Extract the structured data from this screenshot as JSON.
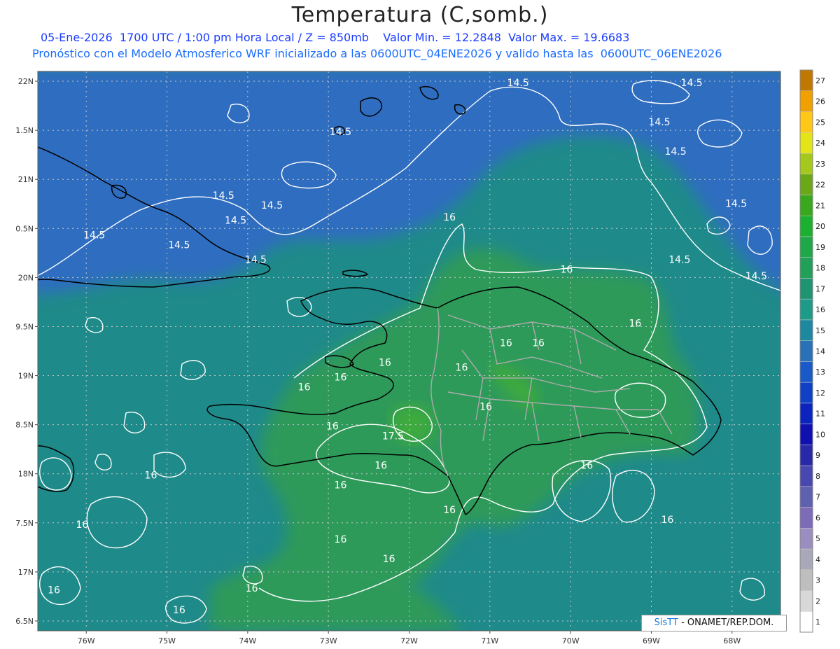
{
  "header": {
    "title": "Temperatura (C,somb.)",
    "line1": "05-Ene-2026  1700 UTC / 1:00 pm Hora Local / Z = 850mb    Valor Min. = 12.2848  Valor Max. = 19.6683",
    "line2": "Pronóstico con el Modelo Atmosferico WRF inicializado a las 0600UTC_04ENE2026 y valido hasta las  0600UTC_06ENE2026"
  },
  "map": {
    "lat_range": [
      16.4,
      22.1
    ],
    "lon_range": [
      -76.6,
      -67.4
    ],
    "lat_ticks": [
      {
        "value": 22,
        "label": "22N"
      },
      {
        "value": 21.5,
        "label": "1.5N"
      },
      {
        "value": 21,
        "label": "21N"
      },
      {
        "value": 20.5,
        "label": "0.5N"
      },
      {
        "value": 20,
        "label": "20N"
      },
      {
        "value": 19.5,
        "label": "9.5N"
      },
      {
        "value": 19,
        "label": "19N"
      },
      {
        "value": 18.5,
        "label": "8.5N"
      },
      {
        "value": 18,
        "label": "18N"
      },
      {
        "value": 17.5,
        "label": "7.5N"
      },
      {
        "value": 17,
        "label": "17N"
      },
      {
        "value": 16.5,
        "label": "6.5N"
      }
    ],
    "lon_ticks": [
      {
        "value": -76,
        "label": "76W"
      },
      {
        "value": -75,
        "label": "75W"
      },
      {
        "value": -74,
        "label": "74W"
      },
      {
        "value": -73,
        "label": "73W"
      },
      {
        "value": -72,
        "label": "72W"
      },
      {
        "value": -71,
        "label": "71W"
      },
      {
        "value": -70,
        "label": "70W"
      },
      {
        "value": -69,
        "label": "69W"
      },
      {
        "value": -68,
        "label": "68W"
      }
    ],
    "colors": {
      "ocean_cold": "#2e6dbf",
      "ocean": "#1f8a8a",
      "land_warm": "#2f9a5a",
      "land_hot": "#3caa3c",
      "contour": "#ffffff",
      "coast": "#000000",
      "border": "#aaaaaa"
    },
    "contour_labels": [
      {
        "text": "14.5",
        "lat": 21.95,
        "lon": -70.65
      },
      {
        "text": "14.5",
        "lat": 21.95,
        "lon": -68.5
      },
      {
        "text": "14.5",
        "lat": 21.55,
        "lon": -68.9
      },
      {
        "text": "14.5",
        "lat": 21.45,
        "lon": -72.85
      },
      {
        "text": "14.5",
        "lat": 21.25,
        "lon": -68.7
      },
      {
        "text": "14.5",
        "lat": 20.8,
        "lon": -74.3
      },
      {
        "text": "14.5",
        "lat": 20.7,
        "lon": -73.7
      },
      {
        "text": "14.5",
        "lat": 20.72,
        "lon": -67.95
      },
      {
        "text": "14.5",
        "lat": 20.55,
        "lon": -74.15
      },
      {
        "text": "14.5",
        "lat": 20.4,
        "lon": -75.9
      },
      {
        "text": "14.5",
        "lat": 20.3,
        "lon": -74.85
      },
      {
        "text": "14.5",
        "lat": 20.15,
        "lon": -73.9
      },
      {
        "text": "14.5",
        "lat": 20.15,
        "lon": -68.65
      },
      {
        "text": "14.5",
        "lat": 19.98,
        "lon": -67.7
      },
      {
        "text": "16",
        "lat": 20.58,
        "lon": -71.5
      },
      {
        "text": "16",
        "lat": 20.05,
        "lon": -70.05
      },
      {
        "text": "16",
        "lat": 19.5,
        "lon": -69.2
      },
      {
        "text": "16",
        "lat": 19.3,
        "lon": -70.8
      },
      {
        "text": "16",
        "lat": 19.3,
        "lon": -70.4
      },
      {
        "text": "16",
        "lat": 19.1,
        "lon": -72.3
      },
      {
        "text": "16",
        "lat": 19.05,
        "lon": -71.35
      },
      {
        "text": "16",
        "lat": 18.95,
        "lon": -72.85
      },
      {
        "text": "16",
        "lat": 18.85,
        "lon": -73.3
      },
      {
        "text": "16",
        "lat": 18.65,
        "lon": -71.05
      },
      {
        "text": "16",
        "lat": 18.45,
        "lon": -72.95
      },
      {
        "text": "16",
        "lat": 18.05,
        "lon": -72.35
      },
      {
        "text": "17.5",
        "lat": 18.35,
        "lon": -72.2
      },
      {
        "text": "16",
        "lat": 18.05,
        "lon": -69.8
      },
      {
        "text": "16",
        "lat": 17.95,
        "lon": -75.2
      },
      {
        "text": "16",
        "lat": 17.85,
        "lon": -72.85
      },
      {
        "text": "16",
        "lat": 17.6,
        "lon": -71.5
      },
      {
        "text": "16",
        "lat": 17.5,
        "lon": -68.8
      },
      {
        "text": "16",
        "lat": 17.45,
        "lon": -76.05
      },
      {
        "text": "16",
        "lat": 17.3,
        "lon": -72.85
      },
      {
        "text": "16",
        "lat": 17.1,
        "lon": -72.25
      },
      {
        "text": "16",
        "lat": 16.8,
        "lon": -73.95
      },
      {
        "text": "16",
        "lat": 16.78,
        "lon": -76.4
      },
      {
        "text": "16",
        "lat": 16.58,
        "lon": -74.85
      }
    ]
  },
  "colorbar": {
    "labels": [
      "1",
      "2",
      "3",
      "4",
      "5",
      "6",
      "7",
      "8",
      "9",
      "10",
      "11",
      "12",
      "13",
      "14",
      "15",
      "16",
      "17",
      "18",
      "19",
      "20",
      "21",
      "22",
      "23",
      "24",
      "25",
      "26",
      "27"
    ],
    "colors": [
      "#ffffff",
      "#d8d8d8",
      "#bebebe",
      "#a8a8b8",
      "#9a8ec0",
      "#7c6cb8",
      "#6060b0",
      "#4848b0",
      "#2828a8",
      "#1010b0",
      "#0b24c0",
      "#1040c8",
      "#1a5ac8",
      "#2a72b8",
      "#1e88a0",
      "#1d9a88",
      "#1f9470",
      "#22a05a",
      "#1ea848",
      "#1cb030",
      "#3aa81c",
      "#6aa818",
      "#a4c81c",
      "#e4e418",
      "#ffc818",
      "#f0a000",
      "#c07800"
    ]
  },
  "credit": {
    "logo": "SisTT",
    "text": " - ONAMET/REP.DOM."
  }
}
